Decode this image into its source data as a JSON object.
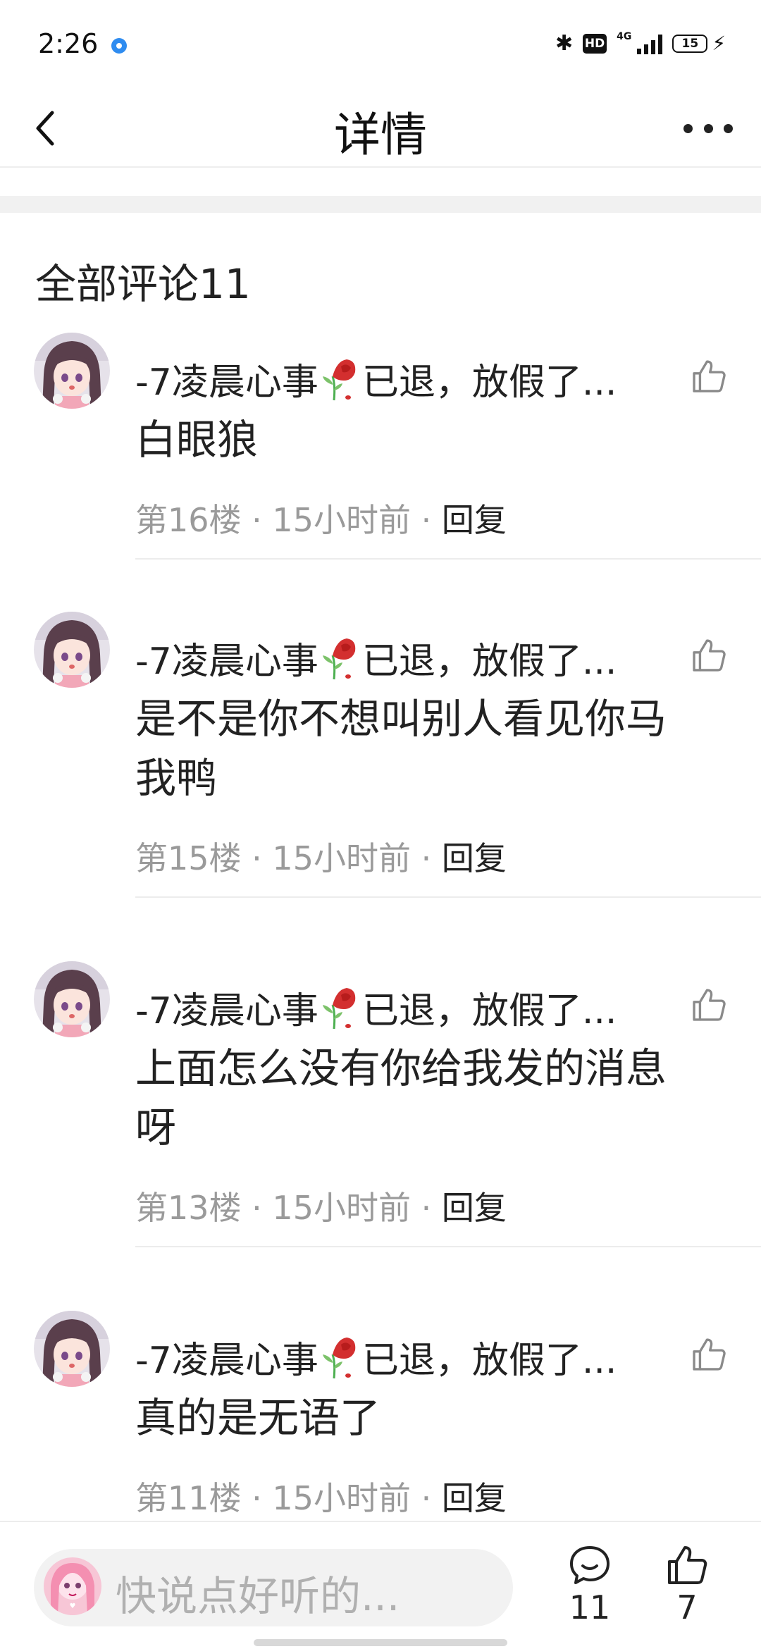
{
  "status_bar": {
    "time": "2:26",
    "hd": "HD",
    "network": "4G",
    "battery": "15"
  },
  "nav": {
    "title": "详情"
  },
  "section": {
    "title": "全部评论11"
  },
  "author_name_prefix": "-7凌晨心事",
  "author_name_suffix": "已退，放假了...",
  "comments": [
    {
      "content": "白眼狼",
      "floor": "第16楼",
      "time": "15小时前",
      "reply": "回复"
    },
    {
      "content": "是不是你不想叫别人看见你马我鸭",
      "floor": "第15楼",
      "time": "15小时前",
      "reply": "回复"
    },
    {
      "content": "上面怎么没有你给我发的消息呀",
      "floor": "第13楼",
      "time": "15小时前",
      "reply": "回复"
    },
    {
      "content": "真的是无语了",
      "floor": "第11楼",
      "time": "15小时前",
      "reply": "回复"
    }
  ],
  "bottom_bar": {
    "placeholder": "快说点好听的...",
    "comment_count": "11",
    "like_count": "7"
  },
  "colors": {
    "accent_dot": "#2f8cf0",
    "meta_gray": "#9a9a9a",
    "text": "#222222"
  },
  "icons": {
    "back": "chevron-left-icon",
    "more": "more-dots-icon",
    "like": "thumbs-up-icon",
    "comment": "comment-bubble-icon",
    "rose": "wilted-rose-emoji"
  }
}
